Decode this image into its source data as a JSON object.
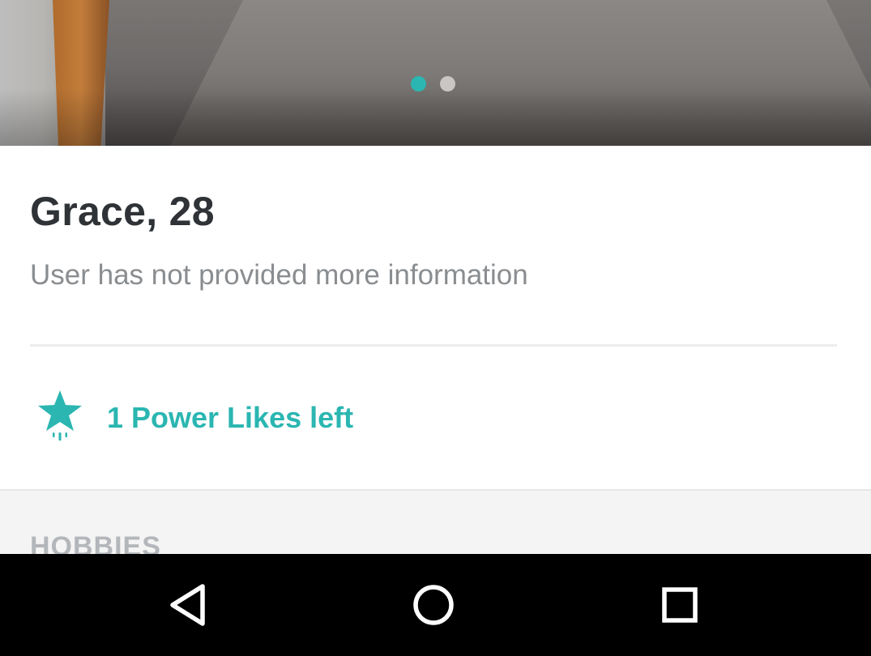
{
  "photo": {
    "pager": {
      "count": 2,
      "active_index": 0
    }
  },
  "profile": {
    "name_age": "Grace, 28",
    "about": "User has not provided more information"
  },
  "power_likes": {
    "icon": "star-icon",
    "label": "1 Power Likes left"
  },
  "hobbies": {
    "title": "HOBBIES"
  },
  "navbar": {
    "back_icon": "back-triangle-icon",
    "home_icon": "home-circle-icon",
    "recent_icon": "recent-apps-square-icon"
  },
  "colors": {
    "accent": "#2bb6b1",
    "name_text": "#2f3236",
    "secondary_text": "#8a8d90",
    "section_header": "#b3b7bb",
    "navbar_bg": "#000000"
  }
}
